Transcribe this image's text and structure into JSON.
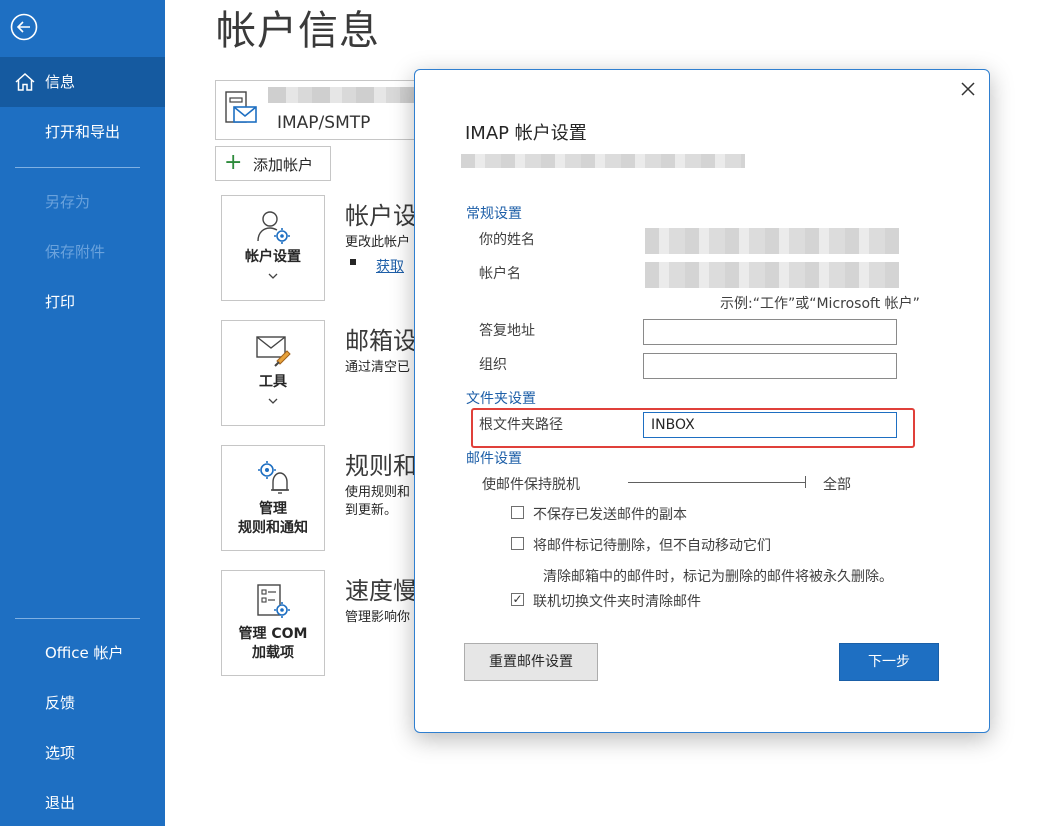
{
  "sidebar": {
    "items": [
      {
        "label": "信息",
        "active": true
      },
      {
        "label": "打开和导出"
      },
      {
        "label": "另存为",
        "disabled": true
      },
      {
        "label": "保存附件",
        "disabled": true
      },
      {
        "label": "打印"
      }
    ],
    "bottom_items": [
      {
        "label": "Office 帐户"
      },
      {
        "label": "反馈"
      },
      {
        "label": "选项"
      },
      {
        "label": "退出"
      }
    ]
  },
  "page": {
    "title": "帐户信息",
    "account_type": "IMAP/SMTP",
    "add_account_label": "添加帐户",
    "tiles": [
      {
        "label": "帐户设置",
        "icon": "account-settings-icon"
      },
      {
        "label": "工具",
        "icon": "tools-icon"
      },
      {
        "label": "管理 规则和通知",
        "line1": "管理",
        "line2": "规则和通知",
        "icon": "rules-alerts-icon"
      },
      {
        "label": "管理 COM 加载项",
        "line1": "管理 COM",
        "line2": "加载项",
        "icon": "com-addins-icon"
      }
    ],
    "sections": [
      {
        "title": "帐户设",
        "desc": "更改此帐户",
        "link": "获取"
      },
      {
        "title": "邮箱设",
        "desc": "通过清空已"
      },
      {
        "title": "规则和",
        "desc": "使用规则和",
        "desc2": "到更新。"
      },
      {
        "title": "速度慢",
        "desc": "管理影响你"
      }
    ]
  },
  "dialog": {
    "title": "IMAP 帐户设置",
    "general_section": "常规设置",
    "your_name_label": "你的姓名",
    "account_name_label": "帐户名",
    "account_name_hint": "示例:“工作”或“Microsoft 帐户”",
    "reply_address_label": "答复地址",
    "reply_address_value": "",
    "organization_label": "组织",
    "organization_value": "",
    "folder_section": "文件夹设置",
    "root_folder_label": "根文件夹路径",
    "root_folder_value": "INBOX",
    "mail_section": "邮件设置",
    "keep_offline_label": "使邮件保持脱机",
    "keep_offline_value": "全部",
    "checkbox_no_sent_copy": "不保存已发送邮件的副本",
    "checkbox_mark_delete": "将邮件标记待删除，但不自动移动它们",
    "purge_note": "清除邮箱中的邮件时，标记为删除的邮件将被永久删除。",
    "checkbox_purge_on_switch": "联机切换文件夹时清除邮件",
    "checkbox_purge_checked": "✓",
    "reset_button": "重置邮件设置",
    "next_button": "下一步"
  },
  "colors": {
    "sidebar": "#1e6fc2",
    "sidebar_active": "#155aa0",
    "accent_text": "#1e5fa8",
    "highlight": "#e0403a",
    "primary_button": "#1e6fc2"
  }
}
